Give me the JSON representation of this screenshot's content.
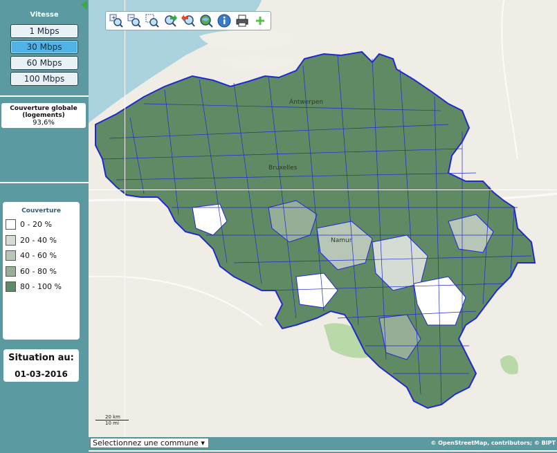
{
  "sidebar": {
    "speed_title": "Vitesse",
    "speeds": [
      {
        "label": "1 Mbps",
        "active": false
      },
      {
        "label": "30 Mbps",
        "active": true
      },
      {
        "label": "60 Mbps",
        "active": false
      },
      {
        "label": "100 Mbps",
        "active": false
      }
    ],
    "coverage_title": "Couverture globale (logements)",
    "coverage_value": "93,6%"
  },
  "legend": {
    "title": "Couverture",
    "items": [
      {
        "label": "0 - 20 %",
        "color": "#ffffff"
      },
      {
        "label": "20 - 40 %",
        "color": "#d4dcd3"
      },
      {
        "label": "40 - 60 %",
        "color": "#b7c6b6"
      },
      {
        "label": "60 - 80 %",
        "color": "#97ae96"
      },
      {
        "label": "80 - 100 %",
        "color": "#5f8a63"
      }
    ]
  },
  "situation": {
    "title": "Situation au:",
    "date": "01-03-2016"
  },
  "toolbar": {
    "tools": [
      "zoom-in-icon",
      "zoom-out-icon",
      "zoom-box-icon",
      "pan-forward-icon",
      "pan-back-icon",
      "full-extent-icon",
      "info-icon",
      "print-icon",
      "add-icon"
    ]
  },
  "map": {
    "places": [
      "Antwerpen",
      "Bruxelles",
      "Namur"
    ],
    "scale_km": "20 km",
    "scale_mi": "10 mi",
    "attribution": "© OpenStreetMap, contributors; © BIPT"
  },
  "commune_select": {
    "placeholder": "Selectionnez une commune"
  },
  "colors": {
    "panel": "#5b9aa0",
    "boundary": "#1e2ad0",
    "coverage_high": "#5f8a63",
    "sea": "#aad3df"
  }
}
